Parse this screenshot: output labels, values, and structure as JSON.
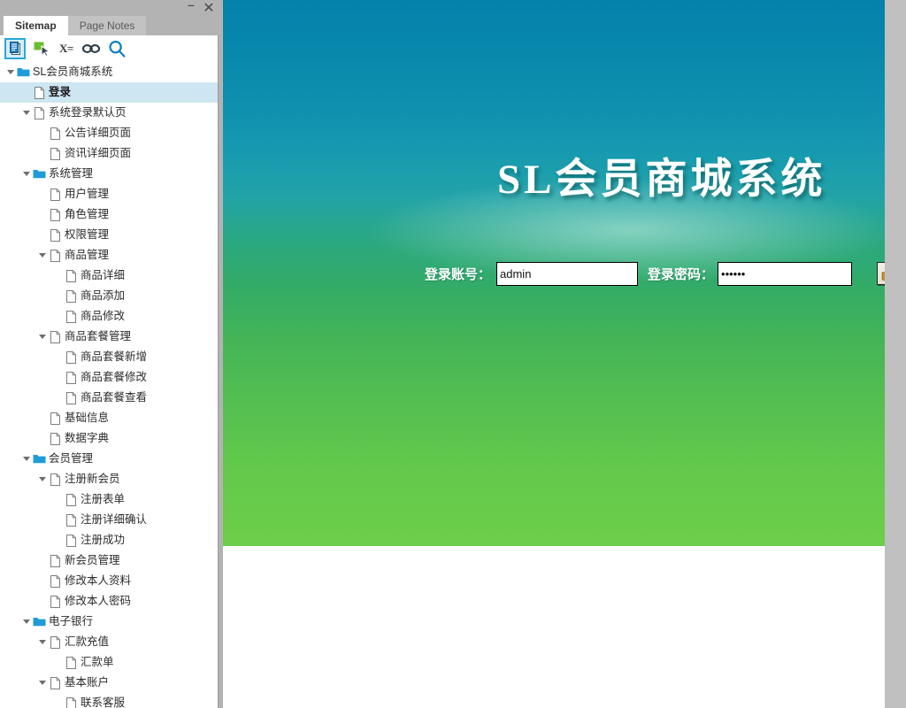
{
  "window": {
    "minimize_label": "–",
    "close_label": "✕"
  },
  "tabs": [
    {
      "label": "Sitemap",
      "active": true
    },
    {
      "label": "Page Notes",
      "active": false
    }
  ],
  "toolbar": {
    "items": [
      {
        "icon": "pages-icon",
        "label": "",
        "selected": true
      },
      {
        "icon": "cursor-select-icon",
        "label": "",
        "selected": false
      },
      {
        "icon": "variables-icon",
        "label": "X=",
        "selected": false
      },
      {
        "icon": "link-icon",
        "label": "",
        "selected": false
      },
      {
        "icon": "search-icon",
        "label": "",
        "selected": false
      }
    ]
  },
  "tree": {
    "items": [
      {
        "label": "SL会员商城系统",
        "depth": 0,
        "icon": "folder-icon",
        "arrow": true,
        "selected": false
      },
      {
        "label": "登录",
        "depth": 1,
        "icon": "page-icon",
        "arrow": false,
        "selected": true
      },
      {
        "label": "系统登录默认页",
        "depth": 1,
        "icon": "page-icon",
        "arrow": true,
        "selected": false
      },
      {
        "label": "公告详细页面",
        "depth": 2,
        "icon": "page-icon",
        "arrow": false,
        "selected": false
      },
      {
        "label": "资讯详细页面",
        "depth": 2,
        "icon": "page-icon",
        "arrow": false,
        "selected": false
      },
      {
        "label": "系统管理",
        "depth": 1,
        "icon": "folder-icon",
        "arrow": true,
        "selected": false
      },
      {
        "label": "用户管理",
        "depth": 2,
        "icon": "page-icon",
        "arrow": false,
        "selected": false
      },
      {
        "label": "角色管理",
        "depth": 2,
        "icon": "page-icon",
        "arrow": false,
        "selected": false
      },
      {
        "label": "权限管理",
        "depth": 2,
        "icon": "page-icon",
        "arrow": false,
        "selected": false
      },
      {
        "label": "商品管理",
        "depth": 2,
        "icon": "page-icon",
        "arrow": true,
        "selected": false
      },
      {
        "label": "商品详细",
        "depth": 3,
        "icon": "page-icon",
        "arrow": false,
        "selected": false
      },
      {
        "label": "商品添加",
        "depth": 3,
        "icon": "page-icon",
        "arrow": false,
        "selected": false
      },
      {
        "label": "商品修改",
        "depth": 3,
        "icon": "page-icon",
        "arrow": false,
        "selected": false
      },
      {
        "label": "商品套餐管理",
        "depth": 2,
        "icon": "page-icon",
        "arrow": true,
        "selected": false
      },
      {
        "label": "商品套餐新增",
        "depth": 3,
        "icon": "page-icon",
        "arrow": false,
        "selected": false
      },
      {
        "label": "商品套餐修改",
        "depth": 3,
        "icon": "page-icon",
        "arrow": false,
        "selected": false
      },
      {
        "label": "商品套餐查看",
        "depth": 3,
        "icon": "page-icon",
        "arrow": false,
        "selected": false
      },
      {
        "label": "基础信息",
        "depth": 2,
        "icon": "page-icon",
        "arrow": false,
        "selected": false
      },
      {
        "label": "数据字典",
        "depth": 2,
        "icon": "page-icon",
        "arrow": false,
        "selected": false
      },
      {
        "label": "会员管理",
        "depth": 1,
        "icon": "folder-icon",
        "arrow": true,
        "selected": false
      },
      {
        "label": "注册新会员",
        "depth": 2,
        "icon": "page-icon",
        "arrow": true,
        "selected": false
      },
      {
        "label": "注册表单",
        "depth": 3,
        "icon": "page-icon",
        "arrow": false,
        "selected": false
      },
      {
        "label": "注册详细确认",
        "depth": 3,
        "icon": "page-icon",
        "arrow": false,
        "selected": false
      },
      {
        "label": "注册成功",
        "depth": 3,
        "icon": "page-icon",
        "arrow": false,
        "selected": false
      },
      {
        "label": "新会员管理",
        "depth": 2,
        "icon": "page-icon",
        "arrow": false,
        "selected": false
      },
      {
        "label": "修改本人资料",
        "depth": 2,
        "icon": "page-icon",
        "arrow": false,
        "selected": false
      },
      {
        "label": "修改本人密码",
        "depth": 2,
        "icon": "page-icon",
        "arrow": false,
        "selected": false
      },
      {
        "label": "电子银行",
        "depth": 1,
        "icon": "folder-icon",
        "arrow": true,
        "selected": false
      },
      {
        "label": "汇款充值",
        "depth": 2,
        "icon": "page-icon",
        "arrow": true,
        "selected": false
      },
      {
        "label": "汇款单",
        "depth": 3,
        "icon": "page-icon",
        "arrow": false,
        "selected": false
      },
      {
        "label": "基本账户",
        "depth": 2,
        "icon": "page-icon",
        "arrow": true,
        "selected": false
      },
      {
        "label": "联系客服",
        "depth": 3,
        "icon": "page-icon",
        "arrow": false,
        "selected": false
      }
    ]
  },
  "page": {
    "banner_title": "SL会员商城系统",
    "login": {
      "account_label": "登录账号：",
      "account_value": "admin",
      "account_placeholder": "",
      "password_label": "登录密码：",
      "password_value": "••••••",
      "password_placeholder": "",
      "submit_icon": "unlock-padlock-icon",
      "submit_label": ""
    }
  },
  "colors": {
    "banner_top": "#0481ab",
    "banner_mid": "#2aa882",
    "banner_bottom": "#6dcf49",
    "selection": "#cde6f2",
    "accent": "#2aa7d8",
    "panel_chrome": "#b3b3b3"
  }
}
